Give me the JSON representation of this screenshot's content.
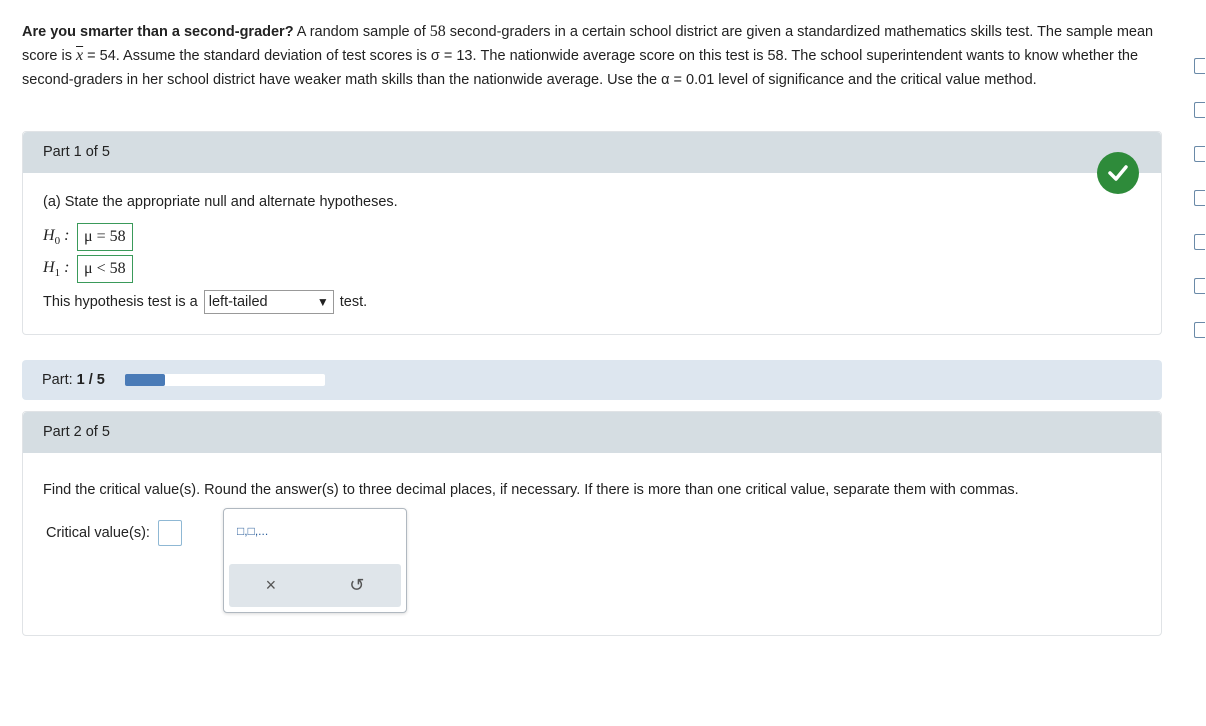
{
  "intro": {
    "lead_bold": "Are you smarter than a second-grader?",
    "s1a": " A random sample of ",
    "n": "58",
    "s1b": " second-graders in a certain school district are given a standardized mathematics skills test. The sample mean score is ",
    "xbar": "x",
    "s1c": " = 54. Assume the standard deviation of test scores is σ = 13. The nationwide average score on this test is 58. The school superintendent wants to know whether the second-graders in her school district have weaker math skills than the nationwide average. Use the α = 0.01 level of significance and the critical value method."
  },
  "part1": {
    "header": "Part 1 of 5",
    "question": "(a) State the appropriate null and alternate hypotheses.",
    "h0_label": "H",
    "h0_sub": "0",
    "h0_value": "μ = 58",
    "h1_label": "H",
    "h1_sub": "1",
    "h1_value": "μ < 58",
    "test_prefix": "This hypothesis test is a",
    "test_selected": "left-tailed",
    "test_suffix": "test.",
    "status": "correct"
  },
  "progress": {
    "label": "Part:",
    "value_text": "1 / 5",
    "fraction": 0.2
  },
  "part2": {
    "header": "Part 2 of 5",
    "question": "Find the critical value(s). Round the answer(s) to three decimal places, if necessary. If there is more than one critical value, separate them with commas.",
    "critical_label": "Critical value(s):",
    "critical_value": "",
    "palette_icon": "□,□,...",
    "palette_clear": "×",
    "palette_undo": "↺"
  },
  "colors": {
    "check_green": "#2e8b3a",
    "progress_fill": "#4a7bb7",
    "panel_header": "#d5dde2"
  }
}
